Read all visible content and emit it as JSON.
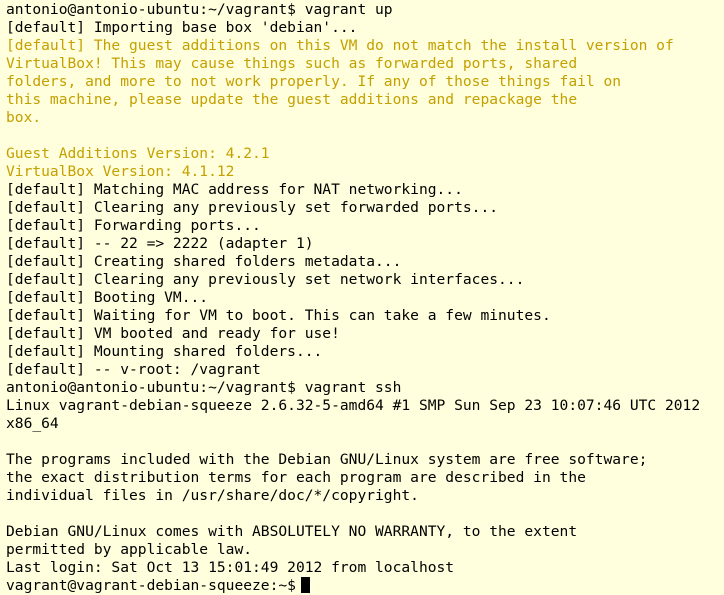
{
  "terminal": {
    "colors": {
      "background": "#ffffdd",
      "text": "#000000",
      "warning": "#c4a000",
      "cursor": "#000000"
    },
    "lines": [
      {
        "text": "antonio@antonio-ubuntu:~/vagrant$ vagrant up",
        "style": "normal"
      },
      {
        "text": "[default] Importing base box 'debian'...",
        "style": "normal"
      },
      {
        "text": "[default] The guest additions on this VM do not match the install version of",
        "style": "warn"
      },
      {
        "text": "VirtualBox! This may cause things such as forwarded ports, shared",
        "style": "warn"
      },
      {
        "text": "folders, and more to not work properly. If any of those things fail on",
        "style": "warn"
      },
      {
        "text": "this machine, please update the guest additions and repackage the",
        "style": "warn"
      },
      {
        "text": "box.",
        "style": "warn"
      },
      {
        "text": "",
        "style": "blank"
      },
      {
        "text": "Guest Additions Version: 4.2.1",
        "style": "warn"
      },
      {
        "text": "VirtualBox Version: 4.1.12",
        "style": "warn"
      },
      {
        "text": "[default] Matching MAC address for NAT networking...",
        "style": "normal"
      },
      {
        "text": "[default] Clearing any previously set forwarded ports...",
        "style": "normal"
      },
      {
        "text": "[default] Forwarding ports...",
        "style": "normal"
      },
      {
        "text": "[default] -- 22 => 2222 (adapter 1)",
        "style": "normal"
      },
      {
        "text": "[default] Creating shared folders metadata...",
        "style": "normal"
      },
      {
        "text": "[default] Clearing any previously set network interfaces...",
        "style": "normal"
      },
      {
        "text": "[default] Booting VM...",
        "style": "normal"
      },
      {
        "text": "[default] Waiting for VM to boot. This can take a few minutes.",
        "style": "normal"
      },
      {
        "text": "[default] VM booted and ready for use!",
        "style": "normal"
      },
      {
        "text": "[default] Mounting shared folders...",
        "style": "normal"
      },
      {
        "text": "[default] -- v-root: /vagrant",
        "style": "normal"
      },
      {
        "text": "antonio@antonio-ubuntu:~/vagrant$ vagrant ssh",
        "style": "normal"
      },
      {
        "text": "Linux vagrant-debian-squeeze 2.6.32-5-amd64 #1 SMP Sun Sep 23 10:07:46 UTC 2012",
        "style": "normal"
      },
      {
        "text": "x86_64",
        "style": "normal"
      },
      {
        "text": "",
        "style": "blank"
      },
      {
        "text": "The programs included with the Debian GNU/Linux system are free software;",
        "style": "normal"
      },
      {
        "text": "the exact distribution terms for each program are described in the",
        "style": "normal"
      },
      {
        "text": "individual files in /usr/share/doc/*/copyright.",
        "style": "normal"
      },
      {
        "text": "",
        "style": "blank"
      },
      {
        "text": "Debian GNU/Linux comes with ABSOLUTELY NO WARRANTY, to the extent",
        "style": "normal"
      },
      {
        "text": "permitted by applicable law.",
        "style": "normal"
      },
      {
        "text": "Last login: Sat Oct 13 15:01:49 2012 from localhost",
        "style": "normal"
      }
    ],
    "prompt": "vagrant@vagrant-debian-squeeze:~$"
  }
}
